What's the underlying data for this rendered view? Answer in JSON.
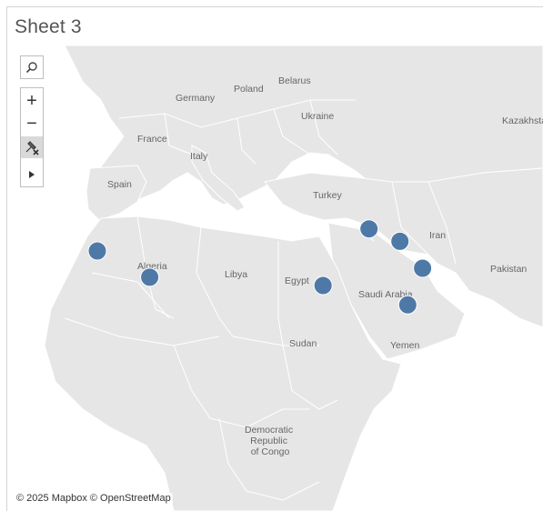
{
  "sheet": {
    "title": "Sheet 3"
  },
  "map": {
    "country_labels": [
      {
        "name": "Germany"
      },
      {
        "name": "Poland"
      },
      {
        "name": "Belarus"
      },
      {
        "name": "Ukraine"
      },
      {
        "name": "France"
      },
      {
        "name": "Italy"
      },
      {
        "name": "Spain"
      },
      {
        "name": "Turkey"
      },
      {
        "name": "Kazakhstan"
      },
      {
        "name": "Iran"
      },
      {
        "name": "Pakistan"
      },
      {
        "name": "Libya"
      },
      {
        "name": "Algeria"
      },
      {
        "name": "Egypt"
      },
      {
        "name": "Saudi Arabia"
      },
      {
        "name": "Sudan"
      },
      {
        "name": "Yemen"
      },
      {
        "name": "Democratic Republic of Congo"
      }
    ],
    "mark_color": "#4e79a7",
    "marks": [
      {
        "name": "mark-morocco",
        "lat": 31.8,
        "lon": -7.1
      },
      {
        "name": "mark-algeria",
        "lat": 28.0,
        "lon": 1.7
      },
      {
        "name": "mark-egypt",
        "lat": 26.8,
        "lon": 30.8
      },
      {
        "name": "mark-syria",
        "lat": 35.0,
        "lon": 38.5
      },
      {
        "name": "mark-iraq",
        "lat": 33.2,
        "lon": 43.7
      },
      {
        "name": "mark-kuwait",
        "lat": 29.3,
        "lon": 47.5
      },
      {
        "name": "mark-saudi-arabia",
        "lat": 24.0,
        "lon": 45.0
      }
    ]
  },
  "controls": {
    "search_icon": "search-icon",
    "zoom_in_label": "+",
    "zoom_out_label": "−",
    "pin_icon": "pin-map-icon",
    "expand_icon": "play-icon"
  },
  "attribution": "© 2025 Mapbox © OpenStreetMap"
}
